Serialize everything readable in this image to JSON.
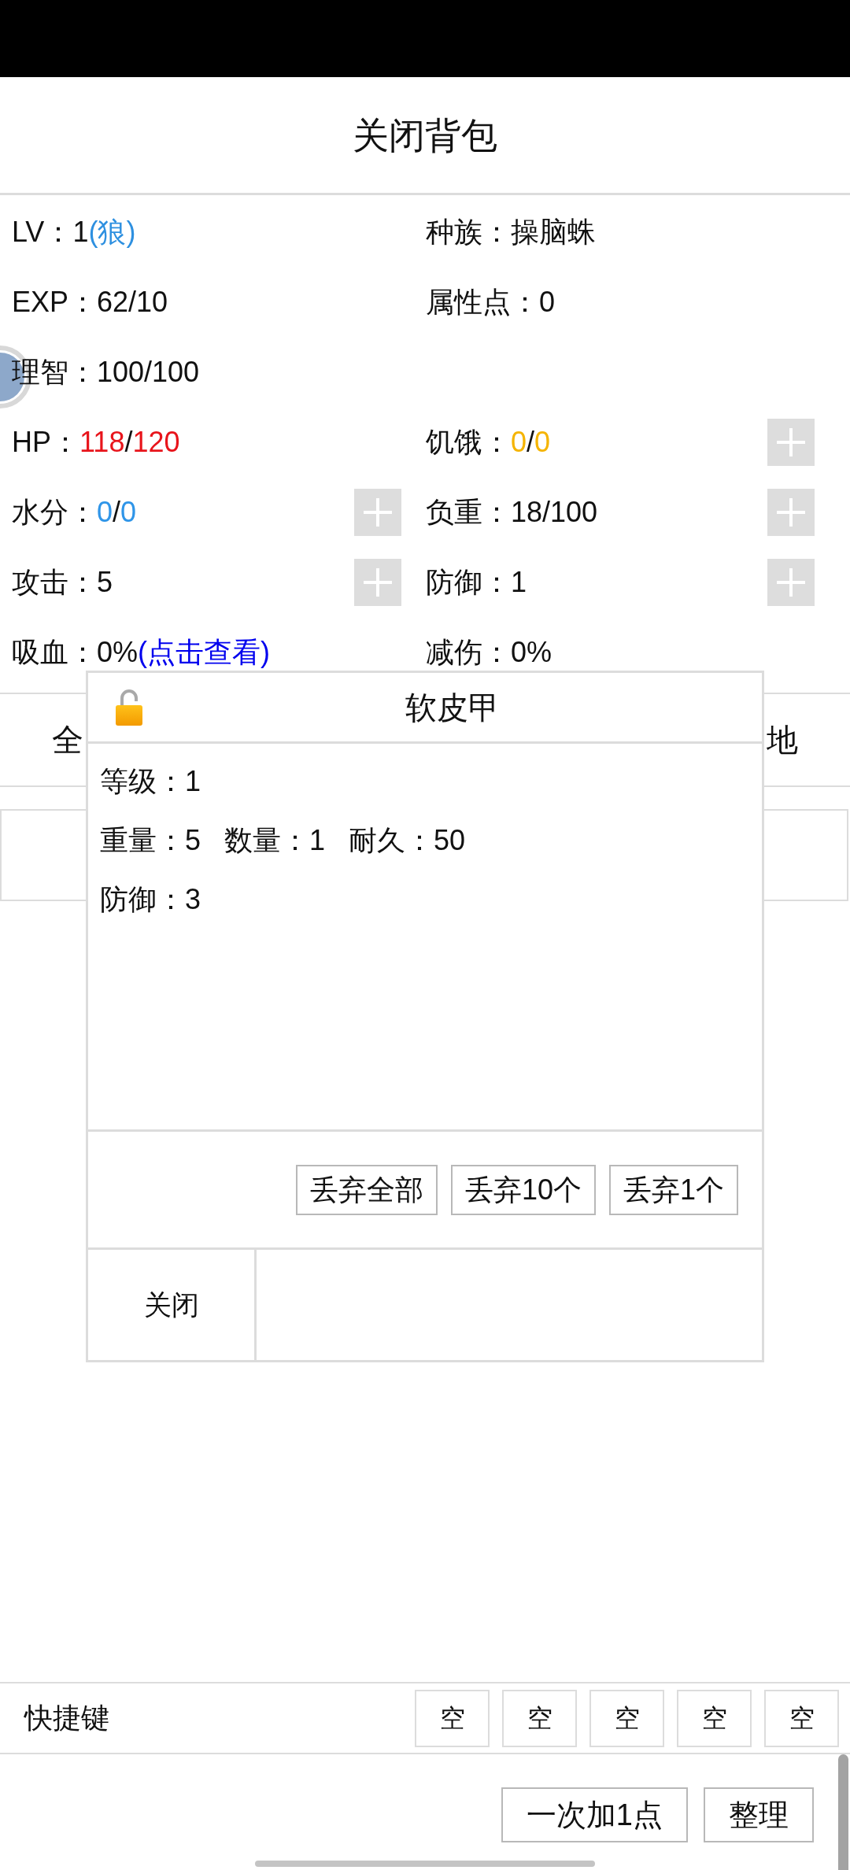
{
  "header": {
    "title": "关闭背包"
  },
  "stats": [
    {
      "cells": [
        {
          "label": "LV：",
          "parts": [
            {
              "text": "1"
            },
            {
              "text": "(狼)",
              "color": "#2e90e0"
            }
          ]
        },
        {
          "label": "种族：",
          "value": "操脑蛛"
        }
      ]
    },
    {
      "cells": [
        {
          "label": "EXP：",
          "value": "62/10"
        },
        {
          "label": "属性点：",
          "value": "0"
        }
      ]
    },
    {
      "cells": [
        {
          "label": "理智：",
          "value": "100/100"
        }
      ]
    },
    {
      "cells": [
        {
          "label": "HP：",
          "parts": [
            {
              "text": "118",
              "color": "#e8141b"
            },
            {
              "text": "/"
            },
            {
              "text": "120",
              "color": "#e8141b"
            }
          ]
        },
        {
          "label": "饥饿：",
          "parts": [
            {
              "text": "0",
              "color": "#f5b400"
            },
            {
              "text": "/"
            },
            {
              "text": "0",
              "color": "#f5b400"
            }
          ],
          "plus": true
        }
      ]
    },
    {
      "cells": [
        {
          "label": "水分：",
          "parts": [
            {
              "text": "0",
              "color": "#2f95e8"
            },
            {
              "text": "/"
            },
            {
              "text": "0",
              "color": "#2f95e8"
            }
          ],
          "plus": true
        },
        {
          "label": "负重：",
          "value": "18/100",
          "plus": true
        }
      ]
    },
    {
      "cells": [
        {
          "label": "攻击：",
          "value": "5",
          "plus": true
        },
        {
          "label": "防御：",
          "value": "1",
          "plus": true
        }
      ]
    },
    {
      "cells": [
        {
          "label": "吸血：",
          "value": "0%",
          "link": "(点击查看)"
        },
        {
          "label": "减伤：",
          "value": "0%"
        }
      ]
    }
  ],
  "tabs": [
    "全",
    "地"
  ],
  "item_dialog": {
    "title": "软皮甲",
    "locked": false,
    "lines": [
      [
        "等级：1"
      ],
      [
        "重量：5",
        "数量：1",
        "耐久：50"
      ],
      [
        "防御：3"
      ]
    ],
    "actions": [
      "丢弃全部",
      "丢弃10个",
      "丢弃1个"
    ],
    "close": "关闭"
  },
  "shortcuts": {
    "label": "快捷键",
    "slots": [
      "空",
      "空",
      "空",
      "空",
      "空"
    ]
  },
  "buttons": [
    "一次加1点",
    "整理"
  ]
}
